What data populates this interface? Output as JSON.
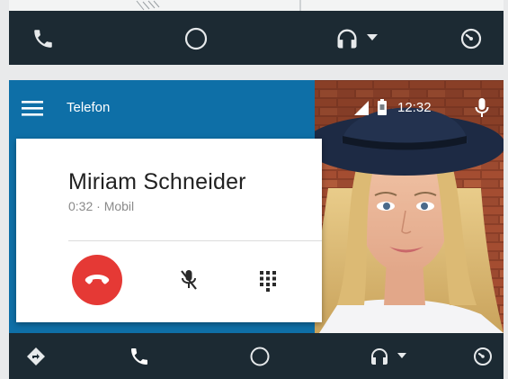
{
  "app": {
    "title": "Telefon",
    "status_time": "12:32"
  },
  "call": {
    "contact_name": "Miriam Schneider",
    "duration": "0:32",
    "separator": "·",
    "number_type": "Mobil",
    "subtitle": "0:32 · Mobil"
  },
  "icons": {
    "menu": "hamburger-menu-icon",
    "signal": "signal-icon",
    "battery": "battery-icon",
    "mic": "microphone-icon",
    "end_call": "call-end-icon",
    "mute": "mic-off-icon",
    "dialpad": "dialpad-icon",
    "nav_phone": "phone-icon",
    "nav_home": "home-circle-icon",
    "nav_audio": "headphones-icon",
    "nav_dropdown": "caret-down-icon",
    "nav_overview": "overview-icon",
    "nav_navigation": "navigation-icon"
  },
  "colors": {
    "app_bar": "#0e6fa7",
    "nav_bar": "#1c2a33",
    "end_call": "#e53935",
    "card": "#ffffff"
  }
}
